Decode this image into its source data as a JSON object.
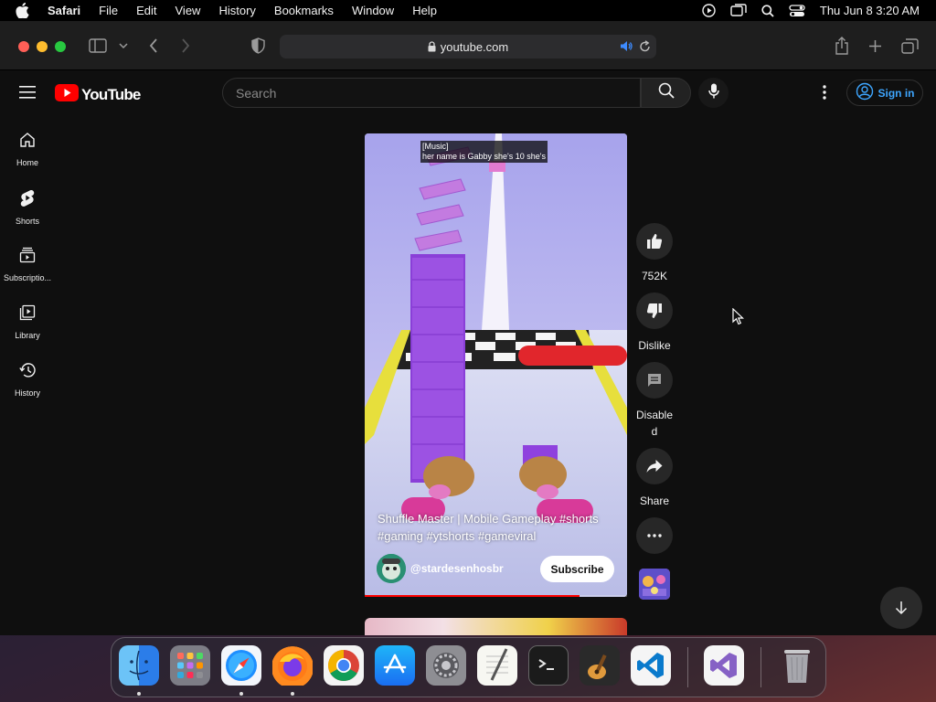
{
  "menubar": {
    "app_name": "Safari",
    "menus": [
      "File",
      "Edit",
      "View",
      "History",
      "Bookmarks",
      "Window",
      "Help"
    ],
    "clock": "Thu Jun 8  3:20 AM"
  },
  "safari": {
    "url": "youtube.com"
  },
  "youtube": {
    "logo_text": "YouTube",
    "search_placeholder": "Search",
    "signin_label": "Sign in",
    "nav": [
      {
        "label": "Home",
        "icon": "home-icon"
      },
      {
        "label": "Shorts",
        "icon": "shorts-icon"
      },
      {
        "label": "Subscriptio...",
        "icon": "subscriptions-icon"
      },
      {
        "label": "Library",
        "icon": "library-icon"
      },
      {
        "label": "History",
        "icon": "history-icon"
      }
    ],
    "short": {
      "caption_line1": "[Music]",
      "caption_line2": "her name is Gabby she's 10 she's",
      "title": "Shuffle Master | Mobile Gameplay #shorts #gaming #ytshorts #gameviral",
      "channel": "@stardesenhosbr",
      "subscribe_label": "Subscribe",
      "progress": 0.82
    },
    "actions": {
      "likes": "752K",
      "dislike_label": "Dislike",
      "comments_label": "Disable\nd",
      "share_label": "Share"
    }
  },
  "dock": {
    "apps": [
      "Finder",
      "Launchpad",
      "Safari",
      "Firefox",
      "Chrome",
      "App Store",
      "System Settings",
      "TextEdit",
      "Terminal",
      "GarageBand",
      "Visual Studio Code",
      "Visual Studio",
      "Trash"
    ]
  }
}
